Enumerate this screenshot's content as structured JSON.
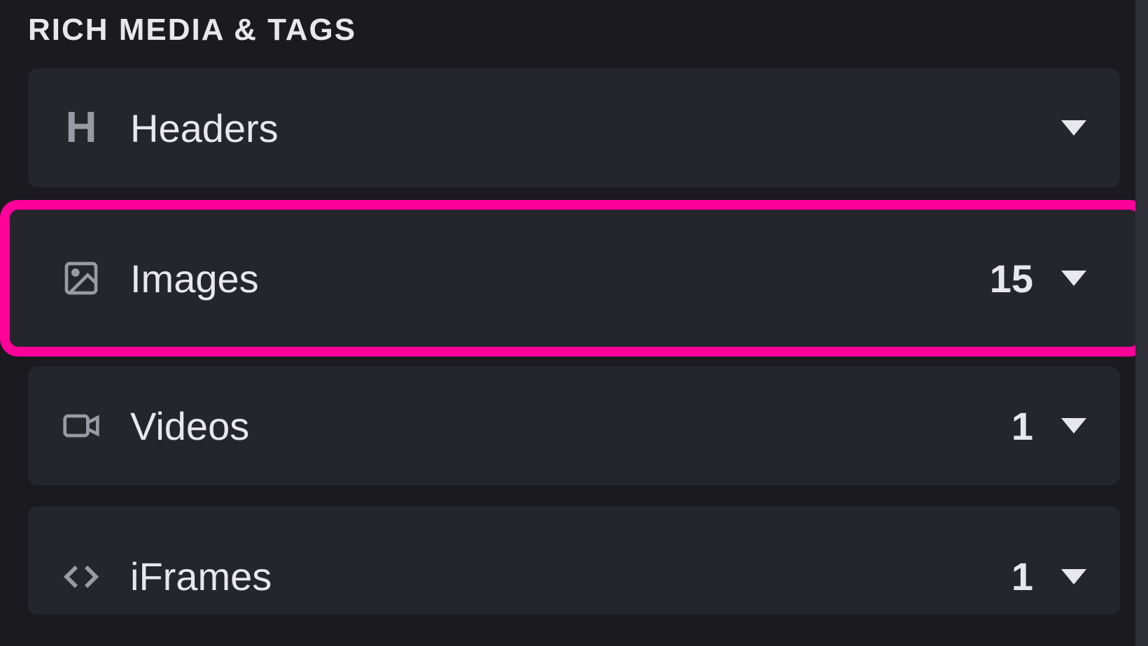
{
  "section": {
    "title": "RICH MEDIA & TAGS"
  },
  "items": [
    {
      "icon": "header-h-icon",
      "label": "Headers",
      "count": "",
      "highlighted": false
    },
    {
      "icon": "image-icon",
      "label": "Images",
      "count": "15",
      "highlighted": true
    },
    {
      "icon": "video-icon",
      "label": "Videos",
      "count": "1",
      "highlighted": false
    },
    {
      "icon": "code-icon",
      "label": "iFrames",
      "count": "1",
      "highlighted": false
    }
  ],
  "colors": {
    "highlight": "#ff0099",
    "background": "#1a1a1f",
    "rowBackground": "#25252c",
    "textPrimary": "#e8e8ec",
    "iconMuted": "#9a9aa5"
  }
}
